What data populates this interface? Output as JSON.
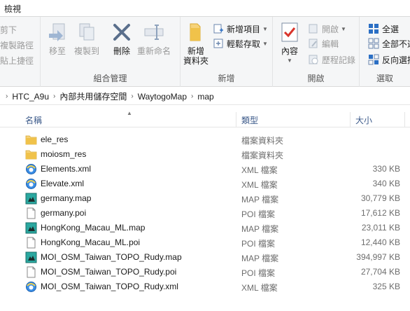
{
  "window": {
    "tab_view": "檢視"
  },
  "ribbon": {
    "clipboard": {
      "cut": "剪下",
      "copy_path": "複製路徑",
      "paste_shortcut": "貼上捷徑"
    },
    "organize": {
      "label": "組合管理",
      "move_to": "移至",
      "copy_to": "複製到",
      "delete": "刪除",
      "rename": "重新命名"
    },
    "new": {
      "label": "新增",
      "new_folder": "新增\n資料夾",
      "new_item": "新增項目",
      "easy_access": "輕鬆存取"
    },
    "open": {
      "label": "開啟",
      "properties": "內容",
      "open": "開啟",
      "edit": "編輯",
      "history": "歷程記錄"
    },
    "select": {
      "label": "選取",
      "select_all": "全選",
      "select_none": "全部不選",
      "invert": "反向選擇"
    }
  },
  "address": {
    "crumbs": [
      "HTC_A9u",
      "內部共用儲存空間",
      "WaytogoMap",
      "map"
    ]
  },
  "columns": {
    "name": "名稱",
    "type": "類型",
    "size": "大小"
  },
  "files": [
    {
      "name": "ele_res",
      "type": "檔案資料夾",
      "size": "",
      "icon": "folder-icon"
    },
    {
      "name": "moiosm_res",
      "type": "檔案資料夾",
      "size": "",
      "icon": "folder-icon"
    },
    {
      "name": "Elements.xml",
      "type": "XML 檔案",
      "size": "330 KB",
      "icon": "xml-file-icon"
    },
    {
      "name": "Elevate.xml",
      "type": "XML 檔案",
      "size": "340 KB",
      "icon": "xml-file-icon"
    },
    {
      "name": "germany.map",
      "type": "MAP 檔案",
      "size": "30,779 KB",
      "icon": "map-file-icon"
    },
    {
      "name": "germany.poi",
      "type": "POI 檔案",
      "size": "17,612 KB",
      "icon": "blank-file-icon"
    },
    {
      "name": "HongKong_Macau_ML.map",
      "type": "MAP 檔案",
      "size": "23,011 KB",
      "icon": "map-file-icon"
    },
    {
      "name": "HongKong_Macau_ML.poi",
      "type": "POI 檔案",
      "size": "12,440 KB",
      "icon": "blank-file-icon"
    },
    {
      "name": "MOI_OSM_Taiwan_TOPO_Rudy.map",
      "type": "MAP 檔案",
      "size": "394,997 KB",
      "icon": "map-file-icon"
    },
    {
      "name": "MOI_OSM_Taiwan_TOPO_Rudy.poi",
      "type": "POI 檔案",
      "size": "27,704 KB",
      "icon": "blank-file-icon"
    },
    {
      "name": "MOI_OSM_Taiwan_TOPO_Rudy.xml",
      "type": "XML 檔案",
      "size": "325 KB",
      "icon": "xml-file-icon"
    }
  ],
  "colors": {
    "accent": "#2b6fc4",
    "folder": "#f0c24a",
    "header_text": "#3c5a8a"
  }
}
